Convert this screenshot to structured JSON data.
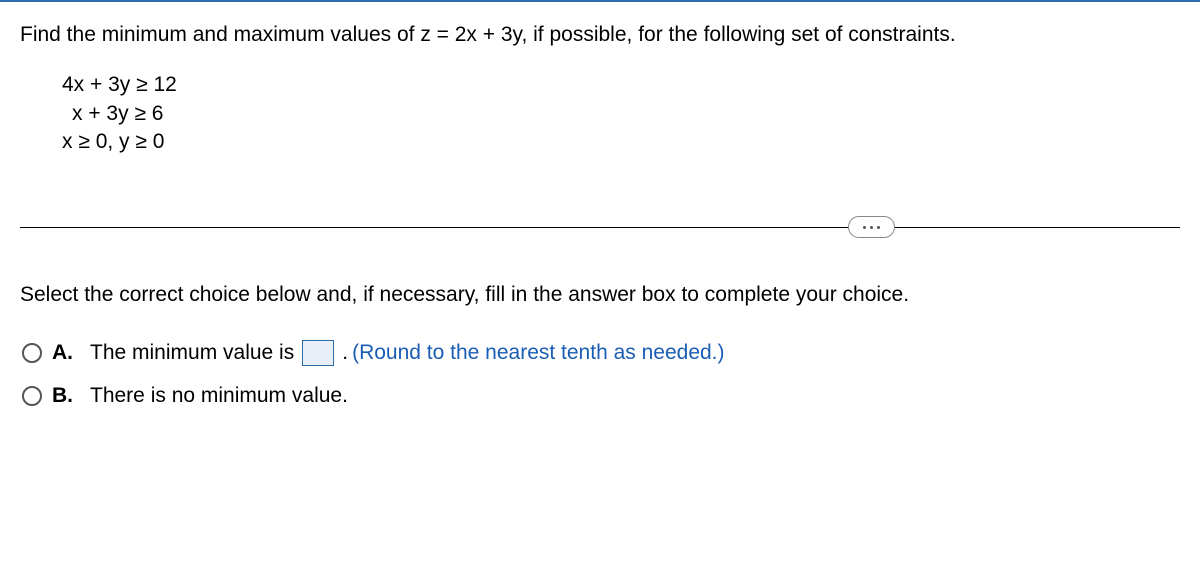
{
  "question": "Find the minimum and maximum values of z = 2x + 3y, if possible, for the following set of constraints.",
  "constraints": [
    "4x + 3y ≥ 12",
    "x + 3y ≥ 6",
    "x ≥ 0, y ≥ 0"
  ],
  "instruction": "Select the correct choice below and, if necessary, fill in the answer box to complete your choice.",
  "choices": {
    "a": {
      "label": "A.",
      "pre": "The minimum value is",
      "post": ".",
      "hint": "(Round to the nearest tenth as needed.)"
    },
    "b": {
      "label": "B.",
      "text": "There is no minimum value."
    }
  }
}
